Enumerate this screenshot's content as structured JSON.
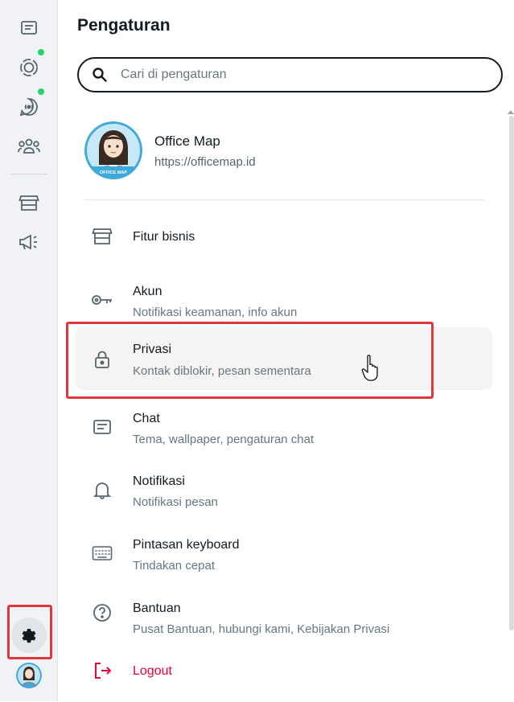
{
  "rail": {
    "items": [
      {
        "name": "chats-icon",
        "badge": false
      },
      {
        "name": "status-icon",
        "badge": true
      },
      {
        "name": "channels-icon",
        "badge": true
      },
      {
        "name": "communities-icon",
        "badge": false
      },
      {
        "name": "store-icon",
        "badge": false
      },
      {
        "name": "megaphone-icon",
        "badge": false
      }
    ],
    "settings_icon": "gear-icon",
    "badge_color": "#25d366"
  },
  "header": {
    "title": "Pengaturan"
  },
  "search": {
    "placeholder": "Cari di pengaturan",
    "value": ""
  },
  "profile": {
    "name": "Office Map",
    "url": "https://officemap.id"
  },
  "menu": [
    {
      "icon": "store-icon",
      "label": "Fitur bisnis",
      "sub": ""
    },
    {
      "icon": "key-icon",
      "label": "Akun",
      "sub": "Notifikasi keamanan, info akun"
    },
    {
      "icon": "lock-icon",
      "label": "Privasi",
      "sub": "Kontak diblokir, pesan sementara"
    },
    {
      "icon": "chat-icon",
      "label": "Chat",
      "sub": "Tema, wallpaper, pengaturan chat"
    },
    {
      "icon": "bell-icon",
      "label": "Notifikasi",
      "sub": "Notifikasi pesan"
    },
    {
      "icon": "keyboard-icon",
      "label": "Pintasan keyboard",
      "sub": "Tindakan cepat"
    },
    {
      "icon": "help-icon",
      "label": "Bantuan",
      "sub": "Pusat Bantuan, hubungi kami, Kebijakan Privasi"
    },
    {
      "icon": "logout-icon",
      "label": "Logout",
      "sub": ""
    }
  ],
  "colors": {
    "accent_green": "#25d366",
    "logout_red": "#ea0038",
    "highlight_box": "#e0373a",
    "hover_bg": "#f5f4f2"
  }
}
